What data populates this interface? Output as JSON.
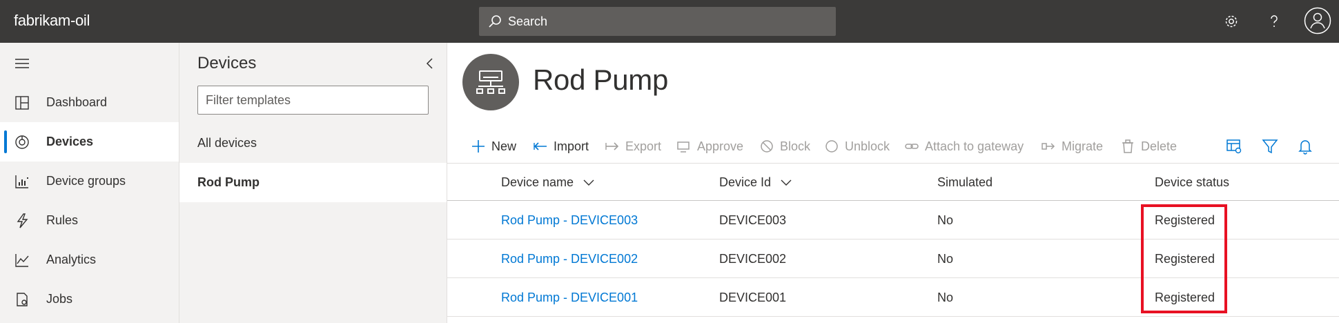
{
  "topbar": {
    "app_name": "fabrikam-oil",
    "search_placeholder": "Search",
    "icons": [
      "gear-icon",
      "help-icon",
      "account-icon"
    ],
    "background": "#3b3a39"
  },
  "leftnav": {
    "items": [
      {
        "label": "Dashboard",
        "icon": "dashboard-icon"
      },
      {
        "label": "Devices",
        "icon": "devices-icon",
        "active": true
      },
      {
        "label": "Device groups",
        "icon": "device-groups-icon"
      },
      {
        "label": "Rules",
        "icon": "rules-icon"
      },
      {
        "label": "Analytics",
        "icon": "analytics-icon"
      },
      {
        "label": "Jobs",
        "icon": "jobs-icon"
      }
    ]
  },
  "devices_panel": {
    "title": "Devices",
    "filter_placeholder": "Filter templates",
    "items": [
      {
        "label": "All devices"
      },
      {
        "label": "Rod Pump",
        "selected": true
      }
    ]
  },
  "main": {
    "title": "Rod Pump",
    "toolbar": {
      "new": "New",
      "import": "Import",
      "export": "Export",
      "approve": "Approve",
      "block": "Block",
      "unblock": "Unblock",
      "attach": "Attach to gateway",
      "migrate": "Migrate",
      "delete": "Delete"
    },
    "table": {
      "columns": [
        "Device name",
        "Device Id",
        "Simulated",
        "Device status"
      ],
      "rows": [
        {
          "name": "Rod Pump - DEVICE003",
          "id": "DEVICE003",
          "simulated": "No",
          "status": "Registered"
        },
        {
          "name": "Rod Pump - DEVICE002",
          "id": "DEVICE002",
          "simulated": "No",
          "status": "Registered"
        },
        {
          "name": "Rod Pump - DEVICE001",
          "id": "DEVICE001",
          "simulated": "No",
          "status": "Registered"
        }
      ]
    }
  },
  "colors": {
    "accent": "#0078d4",
    "highlight": "#e81123",
    "disabled": "#a19f9d"
  }
}
